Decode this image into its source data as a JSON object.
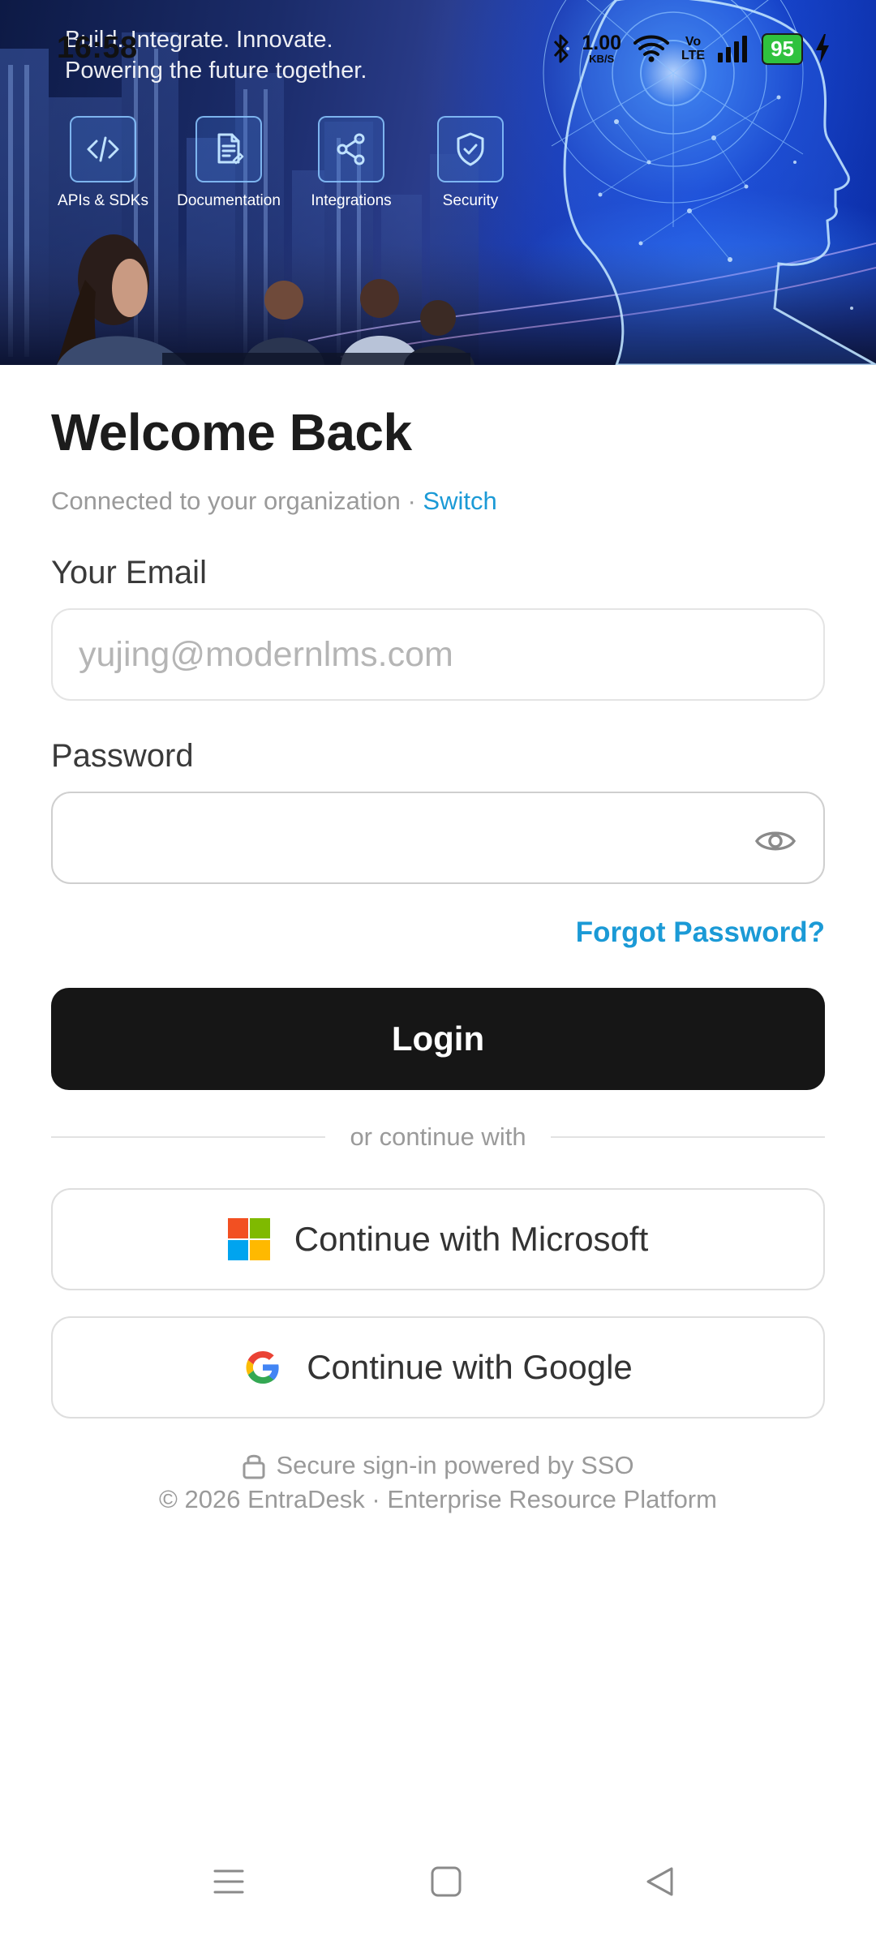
{
  "status_bar": {
    "time": "16:58",
    "net_speed_value": "1.00",
    "net_speed_unit": "KB/S",
    "volte_top": "Vo",
    "volte_bottom": "LTE",
    "battery": "95"
  },
  "hero": {
    "tagline_line1": "Build. Integrate. Innovate.",
    "tagline_line2": "Powering the future together.",
    "features": [
      {
        "label": "APIs & SDKs",
        "icon": "code-icon"
      },
      {
        "label": "Documentation",
        "icon": "document-icon"
      },
      {
        "label": "Integrations",
        "icon": "share-icon"
      },
      {
        "label": "Security",
        "icon": "shield-check-icon"
      }
    ]
  },
  "form": {
    "title": "Welcome Back",
    "subtitle": "Connected to your organization · ",
    "switch_link": "Switch",
    "email_label": "Your Email",
    "email_placeholder": "yujing@modernlms.com",
    "email_value": "",
    "password_label": "Password",
    "password_value": "",
    "forgot_password": "Forgot Password?",
    "login_button": "Login",
    "divider_text": "or continue with",
    "microsoft_button": "Continue with Microsoft",
    "google_button": "Continue with Google"
  },
  "footer": {
    "secure_text": "Secure sign-in powered by SSO",
    "copyright": "© 2026 EntraDesk · Enterprise Resource Platform"
  },
  "colors": {
    "accent": "#1b9ad6",
    "login_button_bg": "#161616",
    "battery_green": "#2fc23e",
    "microsoft_red": "#f25022",
    "microsoft_green": "#7fba00",
    "microsoft_blue": "#00a4ef",
    "microsoft_yellow": "#ffb900"
  }
}
